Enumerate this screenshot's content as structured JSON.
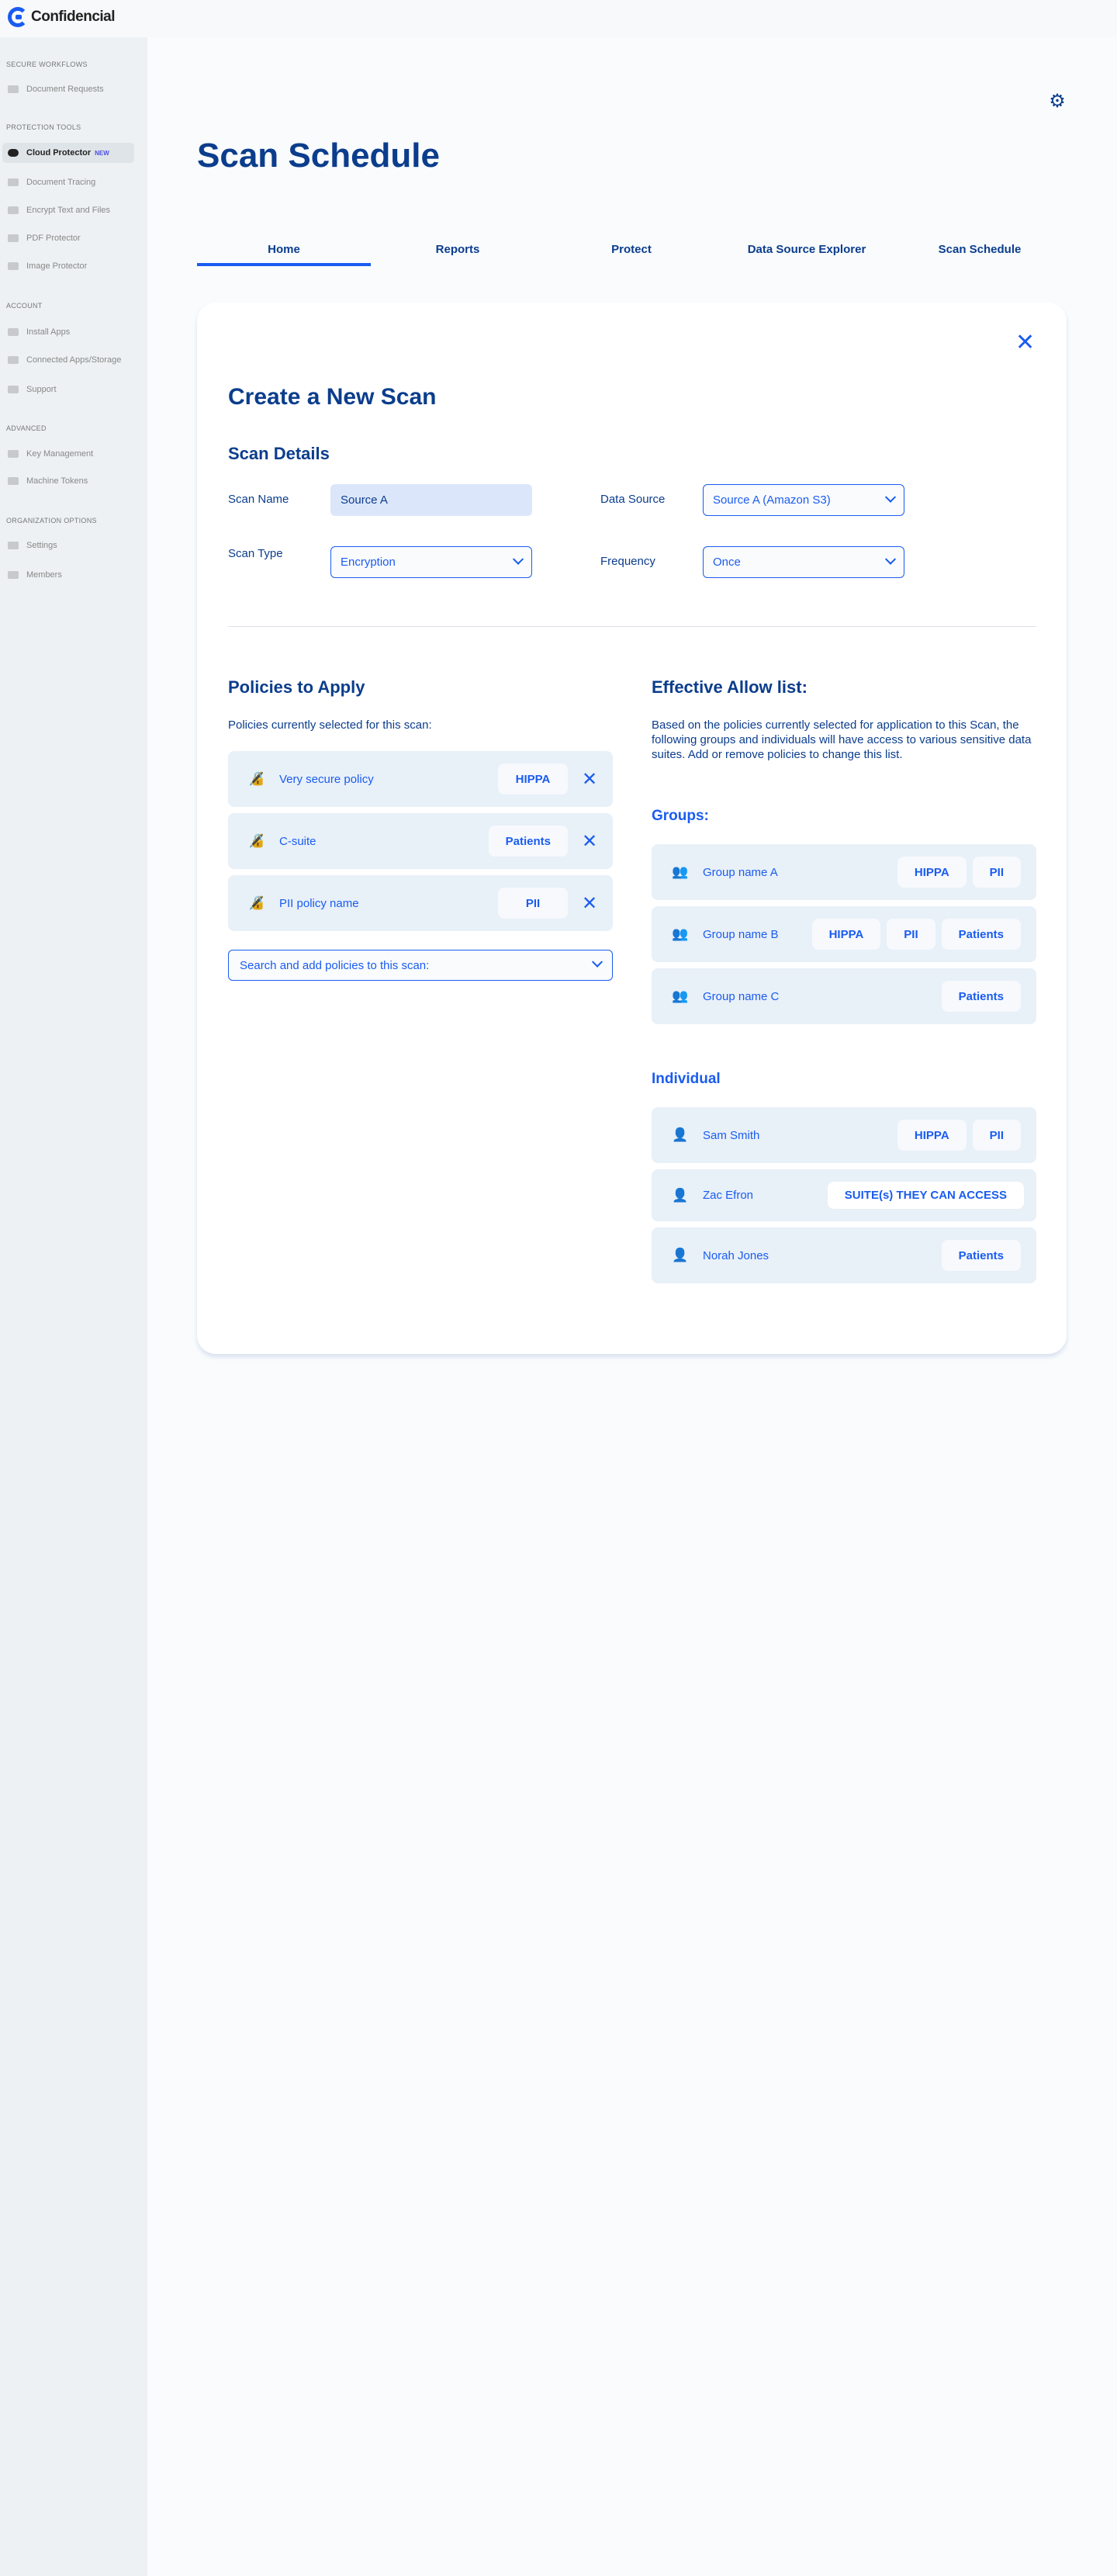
{
  "brand": {
    "name": "Confidencial"
  },
  "sidebar": {
    "sections": [
      {
        "title": "SECURE WORKFLOWS",
        "items": [
          {
            "label": "Document Requests",
            "icon": "send-icon"
          }
        ]
      },
      {
        "title": "PROTECTION TOOLS",
        "items": [
          {
            "label": "Cloud Protector",
            "badge": "NEW",
            "icon": "cloud-icon",
            "active": true
          },
          {
            "label": "Document Tracing",
            "icon": "tracing-icon"
          },
          {
            "label": "Encrypt Text and Files",
            "icon": "lock-icon"
          },
          {
            "label": "PDF Protector",
            "icon": "pdf-icon"
          },
          {
            "label": "Image Protector",
            "icon": "image-icon"
          }
        ]
      },
      {
        "title": "ACCOUNT",
        "items": [
          {
            "label": "Install Apps",
            "icon": "download-icon"
          },
          {
            "label": "Connected Apps/Storage",
            "icon": "plug-icon"
          },
          {
            "label": "Support",
            "icon": "book-icon"
          }
        ]
      },
      {
        "title": "ADVANCED",
        "items": [
          {
            "label": "Key Management",
            "icon": "key-icon"
          },
          {
            "label": "Machine Tokens",
            "icon": "tokens-icon"
          }
        ]
      },
      {
        "title": "ORGANIZATION OPTIONS",
        "items": [
          {
            "label": "Settings",
            "icon": "gear-icon"
          },
          {
            "label": "Members",
            "icon": "members-icon"
          }
        ]
      }
    ]
  },
  "header": {
    "title": "Scan Schedule"
  },
  "tabs": [
    {
      "label": "Home",
      "active": true
    },
    {
      "label": "Reports"
    },
    {
      "label": "Protect"
    },
    {
      "label": "Data Source Explorer"
    },
    {
      "label": "Scan Schedule"
    }
  ],
  "modal": {
    "title": "Create a New Scan",
    "details_title": "Scan Details",
    "scan_name": {
      "label": "Scan Name",
      "value": "Source A"
    },
    "data_source": {
      "label": "Data Source",
      "value": "Source A (Amazon S3)"
    },
    "scan_type": {
      "label": "Scan Type",
      "value": "Encryption"
    },
    "frequency": {
      "label": "Frequency",
      "value": "Once"
    },
    "policies": {
      "title": "Policies to Apply",
      "subtitle": "Policies currently selected for this scan:",
      "items": [
        {
          "name": "Very secure policy",
          "tag": "HIPPA"
        },
        {
          "name": "C-suite",
          "tag": "Patients"
        },
        {
          "name": "PII policy name",
          "tag": "PII"
        }
      ],
      "search_placeholder": "Search and add policies to this scan:"
    },
    "allow_list": {
      "title": "Effective Allow list:",
      "description": "Based on the policies currently selected for application to this Scan, the following groups and individuals will have access to various sensitive data suites. Add or remove policies to change this list.",
      "groups_title": "Groups:",
      "groups": [
        {
          "name": "Group name A",
          "tags": [
            "HIPPA",
            "PII"
          ]
        },
        {
          "name": "Group name B",
          "tags": [
            "HIPPA",
            "PII",
            "Patients"
          ]
        },
        {
          "name": "Group name C",
          "tags": [
            "Patients"
          ]
        }
      ],
      "individual_title": "Individual",
      "individuals": [
        {
          "name": "Sam Smith",
          "tags": [
            "HIPPA",
            "PII"
          ]
        },
        {
          "name": "Zac Efron",
          "tags": [
            "SUITE(s) THEY CAN ACCESS"
          ]
        },
        {
          "name": "Norah Jones",
          "tags": [
            "Patients"
          ]
        }
      ]
    }
  },
  "colors": {
    "primary": "#1a5cf0",
    "navy": "#0b3d8c",
    "row_bg": "#e8f0f8"
  }
}
